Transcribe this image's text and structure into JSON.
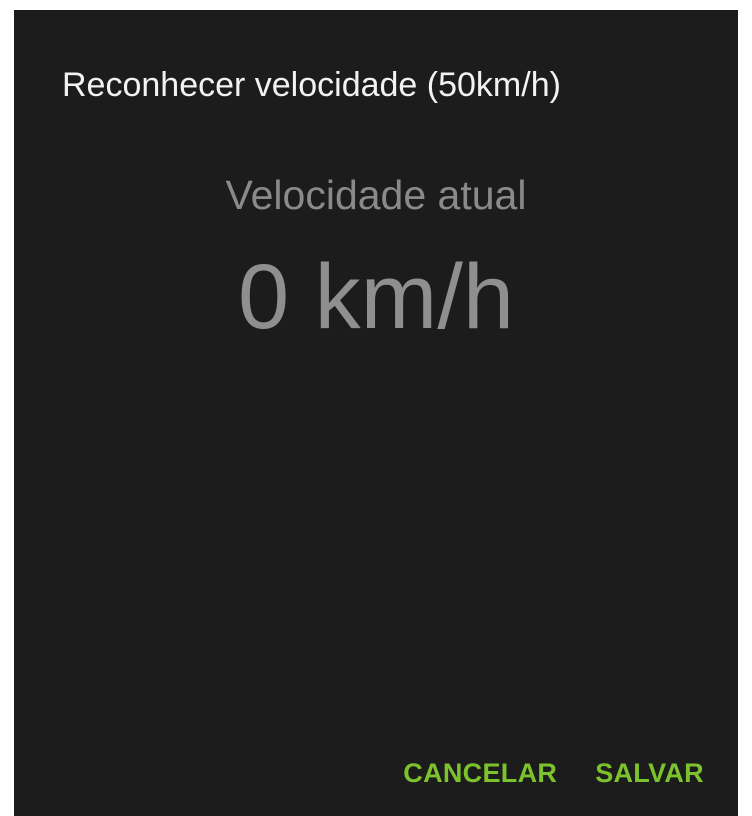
{
  "dialog": {
    "title": "Reconhecer velocidade (50km/h)",
    "speed_label": "Velocidade atual",
    "speed_value": "0 km/h",
    "cancel_label": "CANCELAR",
    "save_label": "SALVAR"
  },
  "colors": {
    "background": "#1c1c1c",
    "title": "#f2f2f2",
    "muted_text": "#8a8a8a",
    "accent": "#7cc22c"
  }
}
